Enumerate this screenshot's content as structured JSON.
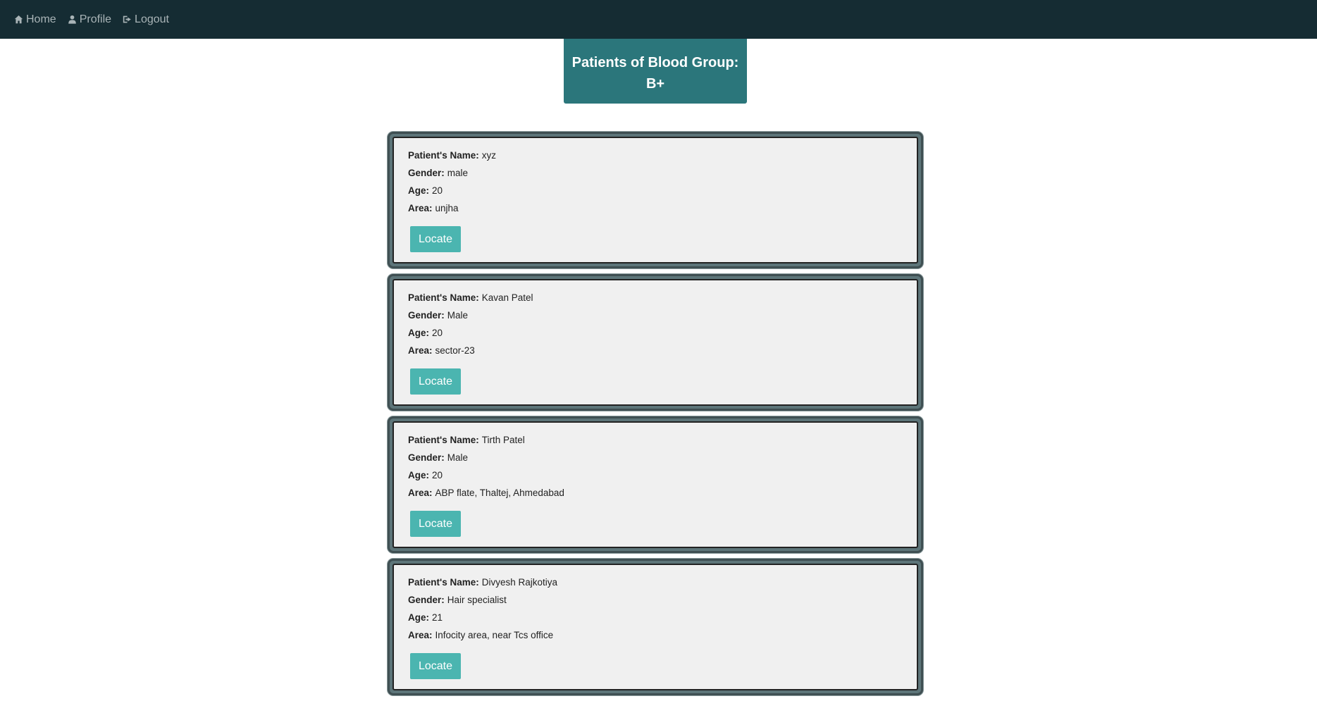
{
  "nav": {
    "home": "Home",
    "profile": "Profile",
    "logout": "Logout"
  },
  "title": {
    "line1": "Patients of Blood Group:",
    "line2": "B+"
  },
  "labels": {
    "name": "Patient's Name:",
    "gender": "Gender:",
    "age": "Age:",
    "area": "Area:",
    "locate": "Locate"
  },
  "patients": [
    {
      "name": "xyz",
      "gender": "male",
      "age": "20",
      "area": "unjha"
    },
    {
      "name": "Kavan Patel",
      "gender": "Male",
      "age": "20",
      "area": "sector-23"
    },
    {
      "name": "Tirth Patel",
      "gender": "Male",
      "age": "20",
      "area": "ABP flate, Thaltej, Ahmedabad"
    },
    {
      "name": "Divyesh Rajkotiya",
      "gender": "Hair specialist",
      "age": "21",
      "area": "Infocity area, near Tcs office"
    }
  ],
  "colors": {
    "navbar": "#152c33",
    "title_bg": "#2b767b",
    "button": "#4bb5b0"
  }
}
